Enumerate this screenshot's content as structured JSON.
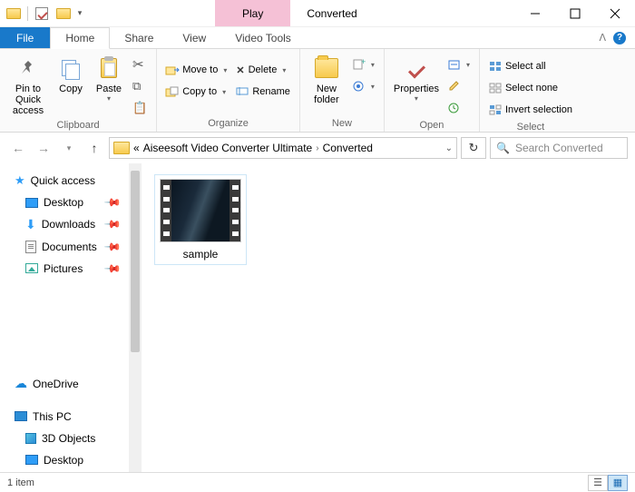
{
  "titlebar": {
    "tool_tab": "Play",
    "tool_subtitle": "Video Tools",
    "window_title": "Converted"
  },
  "tabs": {
    "file": "File",
    "home": "Home",
    "share": "Share",
    "view": "View",
    "video_tools": "Video Tools"
  },
  "ribbon": {
    "clipboard": {
      "label": "Clipboard",
      "pin": "Pin to Quick access",
      "copy": "Copy",
      "paste": "Paste"
    },
    "organize": {
      "label": "Organize",
      "move_to": "Move to",
      "copy_to": "Copy to",
      "delete": "Delete",
      "rename": "Rename"
    },
    "new": {
      "label": "New",
      "new_folder": "New folder"
    },
    "open": {
      "label": "Open",
      "properties": "Properties"
    },
    "select": {
      "label": "Select",
      "select_all": "Select all",
      "select_none": "Select none",
      "invert": "Invert selection"
    }
  },
  "address": {
    "crumb1": "Aiseesoft Video Converter Ultimate",
    "crumb2": "Converted"
  },
  "search": {
    "placeholder": "Search Converted"
  },
  "sidebar": {
    "quick_access": "Quick access",
    "desktop": "Desktop",
    "downloads": "Downloads",
    "documents": "Documents",
    "pictures": "Pictures",
    "onedrive": "OneDrive",
    "this_pc": "This PC",
    "objects_3d": "3D Objects",
    "desktop2": "Desktop"
  },
  "files": {
    "items": [
      {
        "name": "sample"
      }
    ]
  },
  "statusbar": {
    "count": "1 item"
  }
}
